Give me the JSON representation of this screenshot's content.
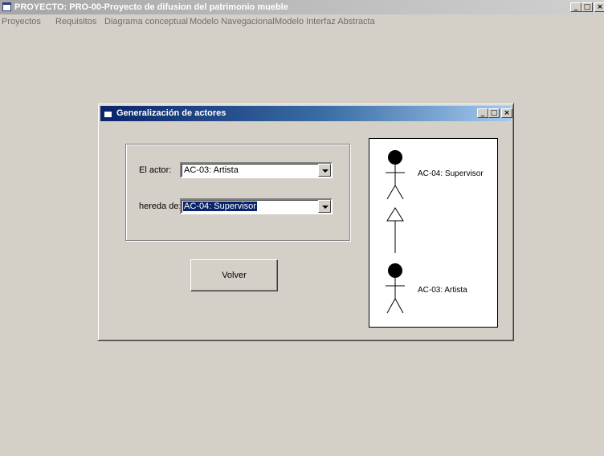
{
  "window": {
    "title": "PROYECTO: PRO-00-Proyecto de difusion del patrimonio mueble",
    "btn_min": "_",
    "btn_max": "□",
    "btn_close": "×"
  },
  "menu": [
    {
      "label": "Proyectos"
    },
    {
      "label": "Requisitos"
    },
    {
      "label": "Diagrama conceptual"
    },
    {
      "label": "Modelo Navegacional"
    },
    {
      "label": "Modelo Interfaz Abstracta"
    }
  ],
  "dialog": {
    "title": "Generalización de actores",
    "btn_min": "_",
    "btn_max": "□",
    "btn_close": "×",
    "actor_label": "El actor:",
    "actor_value": "AC-03: Artista",
    "inherits_label": "hereda de:",
    "inherits_value": "AC-04: Supervisor",
    "back_button": "Volver"
  },
  "diagram": {
    "parent_actor": "AC-04: Supervisor",
    "child_actor": "AC-03: Artista"
  },
  "colors": {
    "face": "#d4d0c8",
    "dialog_title_start": "#0a246a",
    "dialog_title_end": "#a6caf0",
    "selection": "#0a246a"
  }
}
